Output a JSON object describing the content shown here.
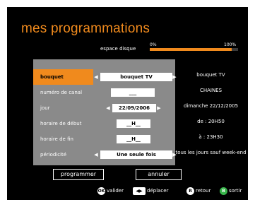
{
  "title": "mes programmations",
  "disk": {
    "label": "espace disque",
    "pct_start": "0%",
    "pct_end": "100%",
    "fill_fraction": 0.93
  },
  "colors": {
    "accent": "#f08a1d",
    "panel": "#8a8a8a",
    "green": "#38b54a"
  },
  "form": {
    "rows": [
      {
        "label": "bouquet",
        "value": "bouquet TV",
        "selected": true
      },
      {
        "label": "numéro de canal",
        "value": "___"
      },
      {
        "label": "jour",
        "value": "22/09/2006"
      },
      {
        "label": "horaire de début",
        "value": "__H__"
      },
      {
        "label": "horaire de fin",
        "value": "__H__"
      },
      {
        "label": "périodicité",
        "value": "Une seule fois"
      }
    ]
  },
  "info": {
    "bouquet": "bouquet TV",
    "chaines": "CHAINES",
    "date": "dimanche 22/12/2005",
    "start": "de : 20H50",
    "end": "à : 23H30",
    "periodicity": "tous les jours sauf week-end"
  },
  "buttons": {
    "program": "programmer",
    "cancel": "annuler"
  },
  "footer": {
    "ok_key": "OK",
    "ok_label": "valider",
    "move_label": "déplacer",
    "r_key": "R",
    "r_label": "retour",
    "b_key": "B",
    "b_label": "sortir"
  },
  "icons": [
    "ok-key-icon",
    "arrows-key-icon",
    "r-key-icon",
    "b-key-icon",
    "left-arrow-icon",
    "right-arrow-icon"
  ]
}
